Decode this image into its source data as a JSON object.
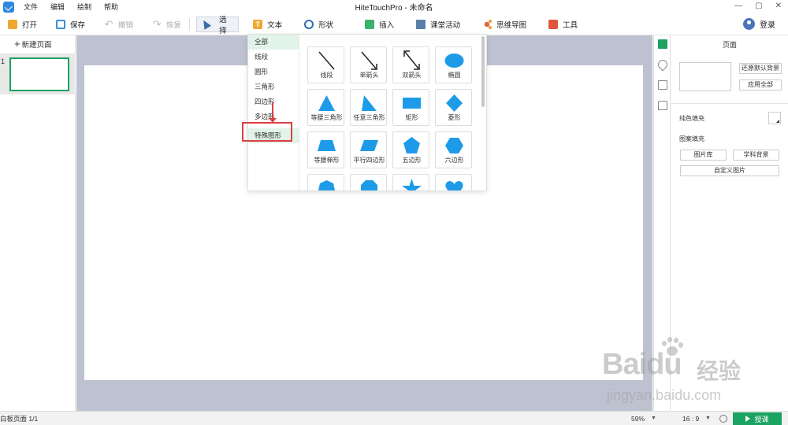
{
  "window": {
    "title": "HiteTouchPro - 未命名",
    "controls": [
      "—",
      "▢",
      "✕"
    ]
  },
  "menu": [
    "文件",
    "编辑",
    "绘制",
    "帮助"
  ],
  "toolbar": {
    "open": "打开",
    "save": "保存",
    "undo": "撤销",
    "redo": "恢复",
    "select": "选择",
    "text": "文本",
    "shape": "形状",
    "insert": "插入",
    "class_activity": "课堂活动",
    "mind_map": "思维导图",
    "tools": "工具",
    "login": "登录"
  },
  "left_panel": {
    "new_page": "新建页面",
    "pages": [
      {
        "number": "1"
      }
    ]
  },
  "shape_dropdown": {
    "categories": [
      "全部",
      "线段",
      "圆形",
      "三角形",
      "四边形",
      "多边形",
      "特殊图形"
    ],
    "active_category": "全部",
    "highlighted_category": "特殊图形",
    "shapes": [
      {
        "label": "线段",
        "icon": "line-icon"
      },
      {
        "label": "单箭头",
        "icon": "single-arrow-icon"
      },
      {
        "label": "双箭头",
        "icon": "double-arrow-icon"
      },
      {
        "label": "椭圆",
        "icon": "ellipse-icon"
      },
      {
        "label": "等腰三角形",
        "icon": "isosceles-triangle-icon"
      },
      {
        "label": "任意三角形",
        "icon": "arbitrary-triangle-icon"
      },
      {
        "label": "矩形",
        "icon": "rectangle-icon"
      },
      {
        "label": "菱形",
        "icon": "rhombus-icon"
      },
      {
        "label": "等腰梯形",
        "icon": "isosceles-trapezoid-icon"
      },
      {
        "label": "平行四边形",
        "icon": "parallelogram-icon"
      },
      {
        "label": "五边形",
        "icon": "pentagon-icon"
      },
      {
        "label": "六边形",
        "icon": "hexagon-icon"
      },
      {
        "label": "",
        "icon": "heptagon-icon"
      },
      {
        "label": "",
        "icon": "octagon-icon"
      },
      {
        "label": "",
        "icon": "star-icon"
      },
      {
        "label": "",
        "icon": "heart-icon"
      }
    ],
    "shape_color": "#1e9be8"
  },
  "right_panel": {
    "title": "页面",
    "restore_default_bg": "还原默认背景",
    "apply_all": "应用全部",
    "solid_fill": "纯色填充",
    "pattern_fill": "图案填充",
    "image_library": "图片库",
    "subject_background": "学科背景",
    "custom_image": "自定义图片"
  },
  "statusbar": {
    "page_info": "白板页面 1/1",
    "zoom": "59%",
    "aspect_ratio": "16 : 9",
    "present": "授课"
  },
  "watermark": {
    "brand": "Baidu",
    "brand_cn": "经验",
    "url": "jingyan.baidu.com"
  },
  "colors": {
    "accent_green": "#1aa361",
    "shape_blue": "#1e9be8",
    "annotation_red": "#d94141",
    "canvas_bg": "#bec2d0"
  }
}
